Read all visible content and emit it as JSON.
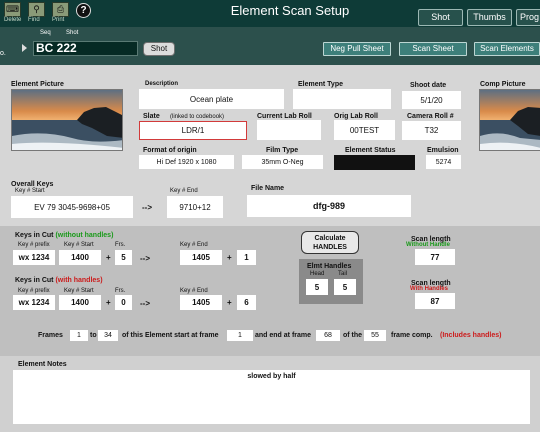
{
  "header": {
    "title": "Element Scan Setup",
    "toolbar": [
      {
        "label": "Delete",
        "icon": "trash-icon"
      },
      {
        "label": "Find",
        "icon": "magnifier-icon"
      },
      {
        "label": "Print",
        "icon": "printer-icon"
      },
      {
        "label": "?",
        "icon": "help-icon"
      }
    ],
    "tabs": [
      "Shot",
      "Thumbs",
      "Prog"
    ]
  },
  "subbar": {
    "left_fragment": "o.",
    "seq_label": "Seq",
    "shot_label": "Shot",
    "shot_value": "BC 222",
    "shot_button": "Shot",
    "neg_pull_sheet": "Neg Pull Sheet",
    "scan_sheet": "Scan Sheet",
    "scan_elements": "Scan Elements"
  },
  "info": {
    "element_picture_label": "Element Picture",
    "comp_picture_label": "Comp Picture",
    "description_label": "Description",
    "description": "Ocean plate",
    "element_type_label": "Element Type",
    "element_type": "",
    "shoot_date_label": "Shoot date",
    "shoot_date": "5/1/20",
    "slate_label": "Slate",
    "slate_note": "(linked to codebook)",
    "slate": "LDR/1",
    "current_lab_roll_label": "Current Lab Roll",
    "current_lab_roll": "",
    "orig_lab_roll_label": "Orig Lab Roll",
    "orig_lab_roll": "00TEST",
    "camera_roll_label": "Camera Roll #",
    "camera_roll": "T32",
    "format_label": "Format of origin",
    "format": "Hi Def 1920 x 1080",
    "film_type_label": "Film Type",
    "film_type": "35mm O-Neg",
    "element_status_label": "Element Status",
    "emulsion_label": "Emulsion",
    "emulsion": "5274"
  },
  "keys": {
    "overall_label": "Overall Keys",
    "key_start_label": "Key # Start",
    "key_start": "EV 79 3045-9698+05",
    "arrow": "-->",
    "key_end_label": "Key # End",
    "key_end": "9710+12",
    "file_name_label": "File Name",
    "file_name": "dfg-989"
  },
  "cut": {
    "kic_label": "Keys in Cut",
    "without_handles": "(without handles)",
    "with_handles": "(with handles)",
    "key_prefix_label": "Key # prefix",
    "key_start_label": "Key # Start",
    "frs_label": "Frs.",
    "key_end_label": "Key # End",
    "plus": "+",
    "arrow": "-->",
    "row1": {
      "prefix": "wx 1234",
      "start": "1400",
      "frs": "5",
      "end": "1405",
      "end_frs": "1"
    },
    "row2": {
      "prefix": "wx 1234",
      "start": "1400",
      "frs": "0",
      "end": "1405",
      "end_frs": "6"
    },
    "calc_button": "Calculate HANDLES",
    "elmt_handles_label": "Elmt Handles",
    "head_label": "Head",
    "tail_label": "Tail",
    "head": "5",
    "tail": "5",
    "scan_length_label": "Scan length",
    "without_handle": "Without Handle",
    "with_handles_cap": "With Handles",
    "scan_without": "77",
    "scan_with": "87"
  },
  "frames": {
    "frames_label": "Frames",
    "from": "1",
    "to_label": "to",
    "to": "34",
    "text1": "of this Element start at frame",
    "start_frame": "1",
    "text2": "and end at frame",
    "end_frame": "68",
    "text3": "of the",
    "comp_frames": "55",
    "text4": "frame comp.",
    "includes": "(Includes handles)"
  },
  "notes": {
    "label": "Element Notes",
    "text": "slowed by half"
  },
  "colors": {
    "header_bg": "#0e3b37",
    "subbar_bg": "#2c504c",
    "button_teal": "#3d7f7a",
    "green_text": "#1a9a1a",
    "red_text": "#cc1b1b"
  }
}
